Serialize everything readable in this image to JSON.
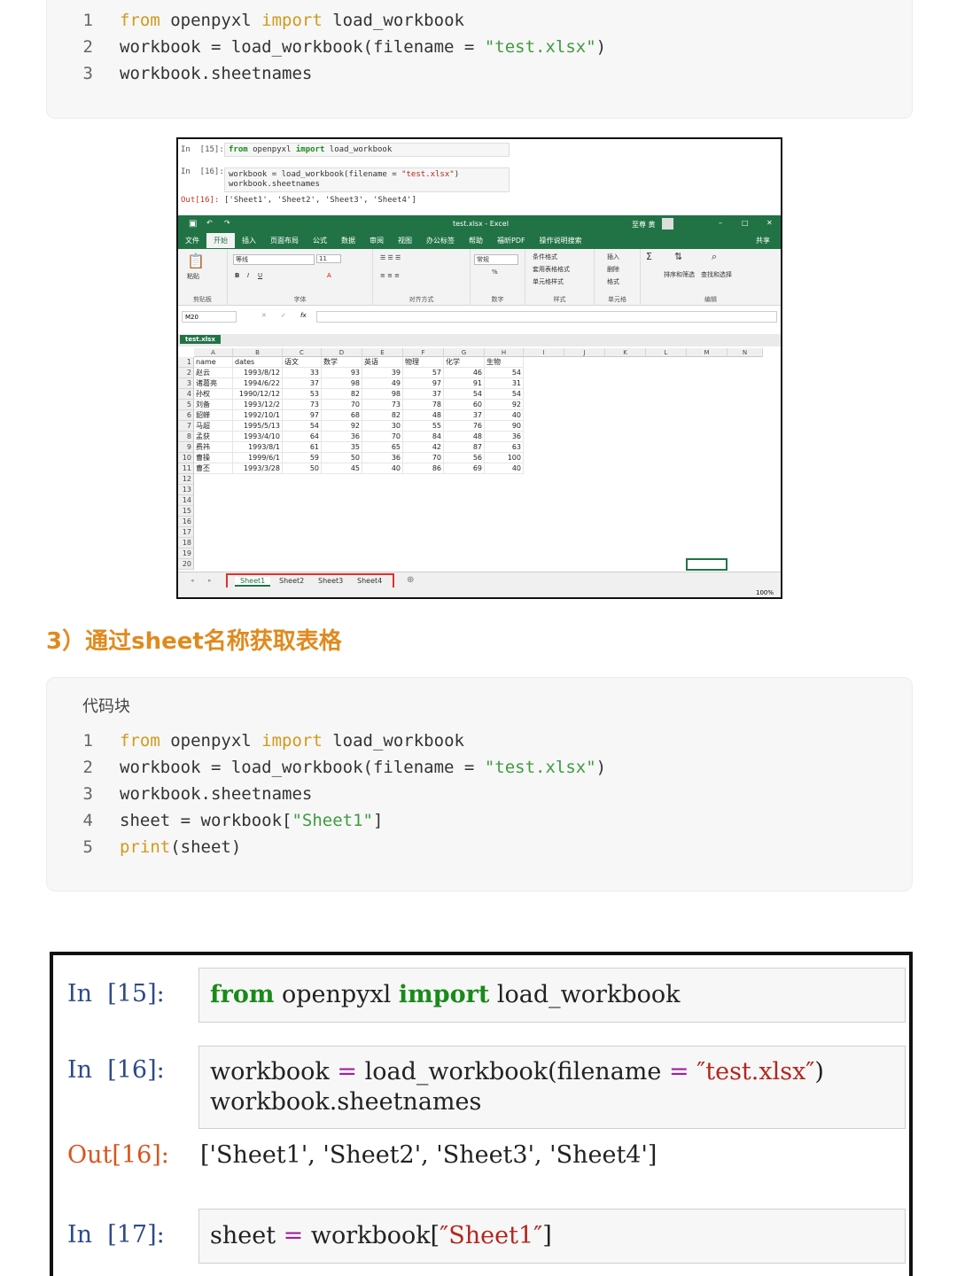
{
  "code_block_1": {
    "lines": [
      {
        "num": "1",
        "kw1": "from",
        "mid": " openpyxl ",
        "kw2": "import",
        "rest": " load_workbook"
      },
      {
        "num": "2",
        "pre": "workbook = load_workbook(filename = ",
        "str": "\"test.xlsx\"",
        "post": ")"
      },
      {
        "num": "3",
        "text": "workbook.sheetnames"
      }
    ]
  },
  "screenshot1": {
    "notebook": {
      "in15_prompt": "In  [15]:",
      "in15_kw1": "from",
      "in15_mid": " openpyxl ",
      "in15_kw2": "import",
      "in15_rest": " load_workbook",
      "in16_prompt": "In  [16]:",
      "in16_line1_pre": "workbook = load_workbook(filename = ",
      "in16_line1_str": "\"test.xlsx\"",
      "in16_line1_post": ")",
      "in16_line2": "workbook.sheetnames",
      "out16_prompt": "Out[16]:",
      "out16_value": "['Sheet1', 'Sheet2', 'Sheet3', 'Sheet4']"
    },
    "excel": {
      "window_title": "test.xlsx  -  Excel",
      "user": "至尊 黄",
      "tabs": [
        "文件",
        "开始",
        "插入",
        "页面布局",
        "公式",
        "数据",
        "审阅",
        "视图",
        "办公标签",
        "帮助",
        "福昕PDF",
        "操作说明搜索"
      ],
      "share": "共享",
      "ribbon": {
        "paste": "粘贴",
        "clipboard": "剪贴板",
        "font_name": "等线",
        "font_size": "11",
        "font_group": "字体",
        "align_group": "对齐方式",
        "number_format": "常规",
        "number_group": "数字",
        "cond_format": "条件格式",
        "table_format": "套用表格格式",
        "cell_style": "单元格样式",
        "style_group": "样式",
        "insert": "插入",
        "delete": "删除",
        "format": "格式",
        "cells_group": "单元格",
        "sort_filter": "排序和筛选",
        "find_select": "查找和选择",
        "edit_group": "编辑"
      },
      "name_box": "M20",
      "fx": "fx",
      "workbook_tab": "test.xlsx",
      "columns": [
        "A",
        "B",
        "C",
        "D",
        "E",
        "F",
        "G",
        "H",
        "I",
        "J",
        "K",
        "L",
        "M",
        "N"
      ],
      "header_row": [
        "name",
        "dates",
        "语文",
        "数学",
        "英语",
        "物理",
        "化学",
        "生物"
      ],
      "rows": [
        [
          "赵云",
          "1993/8/12",
          "33",
          "93",
          "39",
          "57",
          "46",
          "54"
        ],
        [
          "诸葛亮",
          "1994/6/22",
          "37",
          "98",
          "49",
          "97",
          "91",
          "31"
        ],
        [
          "孙权",
          "1990/12/12",
          "53",
          "82",
          "98",
          "37",
          "54",
          "54"
        ],
        [
          "刘备",
          "1993/12/2",
          "73",
          "70",
          "73",
          "78",
          "60",
          "92"
        ],
        [
          "貂蝉",
          "1992/10/1",
          "97",
          "68",
          "82",
          "48",
          "37",
          "40"
        ],
        [
          "马超",
          "1995/5/13",
          "54",
          "92",
          "30",
          "55",
          "76",
          "90"
        ],
        [
          "孟获",
          "1993/4/10",
          "64",
          "36",
          "70",
          "84",
          "48",
          "36"
        ],
        [
          "费祎",
          "1993/8/1",
          "61",
          "35",
          "65",
          "42",
          "87",
          "63"
        ],
        [
          "曹操",
          "1999/6/1",
          "59",
          "50",
          "36",
          "70",
          "56",
          "100"
        ],
        [
          "曹丕",
          "1993/3/28",
          "50",
          "45",
          "40",
          "86",
          "69",
          "40"
        ]
      ],
      "row_numbers": [
        "1",
        "2",
        "3",
        "4",
        "5",
        "6",
        "7",
        "8",
        "9",
        "10",
        "11",
        "12",
        "13",
        "14",
        "15",
        "16",
        "17",
        "18",
        "19",
        "20"
      ],
      "sheets": [
        "Sheet1",
        "Sheet2",
        "Sheet3",
        "Sheet4"
      ],
      "zoom": "100%"
    }
  },
  "heading": "3）通过sheet名称获取表格",
  "code_block_2": {
    "title": "代码块",
    "lines": [
      {
        "num": "1",
        "kw1": "from",
        "mid": " openpyxl ",
        "kw2": "import",
        "rest": " load_workbook"
      },
      {
        "num": "2",
        "pre": "workbook = load_workbook(filename = ",
        "str": "\"test.xlsx\"",
        "post": ")"
      },
      {
        "num": "3",
        "text": "workbook.sheetnames"
      },
      {
        "num": "4",
        "pre": "sheet = workbook[",
        "str": "\"Sheet1\"",
        "post": "]"
      },
      {
        "num": "5",
        "fn": "print",
        "post": "(sheet)"
      }
    ]
  },
  "screenshot2": {
    "in15_prompt": "In  [15]:",
    "in15_kw1": "from",
    "in15_mid": " openpyxl ",
    "in15_kw2": "import",
    "in15_rest": " load_workbook",
    "in16_prompt": "In  [16]:",
    "in16_line1_pre": "workbook ",
    "in16_eq1": "=",
    "in16_line1_mid": " load_workbook(filename ",
    "in16_eq2": "=",
    "in16_line1_str": " ″test.xlsx″",
    "in16_line1_post": ")",
    "in16_line2": "workbook.sheetnames",
    "out16_prompt": "Out[16]:",
    "out16_value": "['Sheet1', 'Sheet2', 'Sheet3', 'Sheet4']",
    "in17_prompt": "In  [17]:",
    "in17_pre": "sheet ",
    "in17_eq": "=",
    "in17_mid": " workbook[",
    "in17_str": "″Sheet1″",
    "in17_post": "]"
  }
}
